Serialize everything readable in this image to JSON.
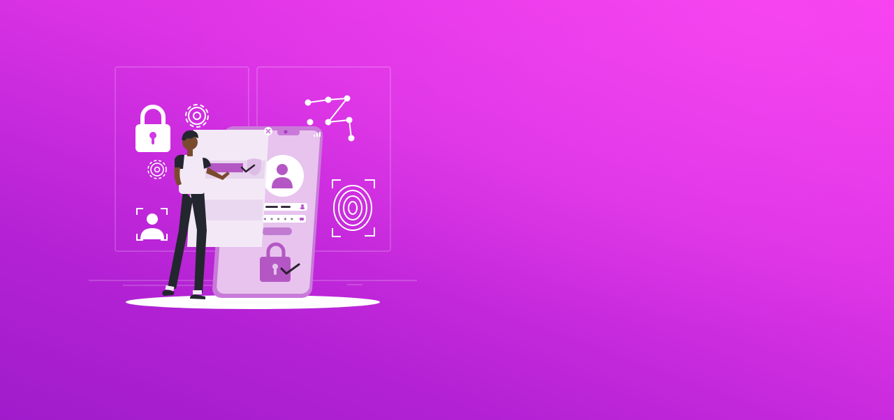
{
  "hero": {
    "background": {
      "gradient_colors": [
        "#f53aef",
        "#db33e5",
        "#b322d4",
        "#a01ccb"
      ]
    },
    "illustration": {
      "subject": "person-at-phone-login-screen",
      "phone": {
        "password_mask": "* * * * *",
        "icons": [
          "close-icon",
          "user-icon",
          "lock-icon",
          "check-icon",
          "signal-icon"
        ]
      },
      "background_icons": [
        "padlock-icon",
        "gear-icon",
        "pattern-lock-icon",
        "fingerprint-icon",
        "face-scan-icon",
        "shield-check-icon"
      ],
      "colors": {
        "phone_body": "#d7a2e4",
        "phone_screen": "#e7c3ee",
        "accent": "#b457c4",
        "panel": "#f3e9f6",
        "skin": "#7a4a2e",
        "pants": "#22252c",
        "floor": "#ffffff"
      }
    }
  }
}
